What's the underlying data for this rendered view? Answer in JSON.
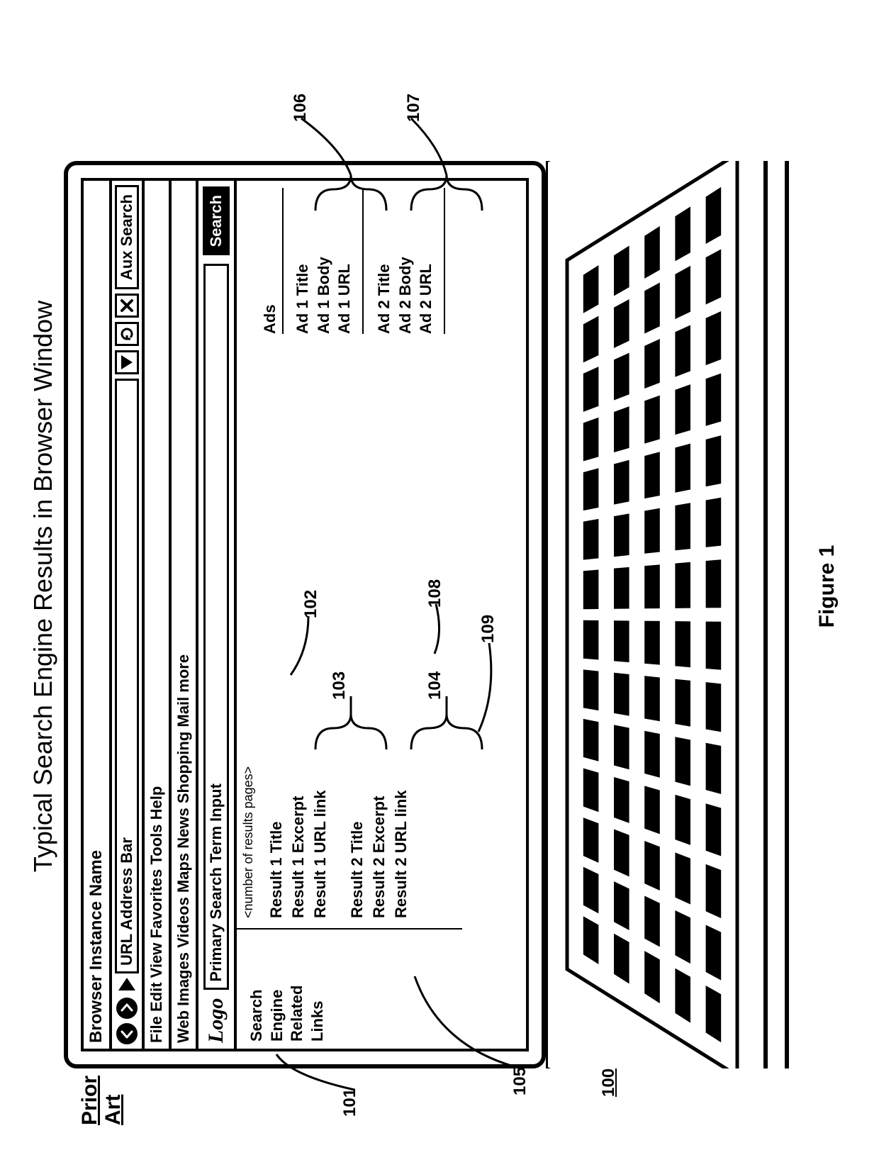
{
  "page_title": "Typical Search Engine Results in Browser Window",
  "prior_art": {
    "l1": "Prior",
    "l2": "Art"
  },
  "figure_label": "Figure 1",
  "browser": {
    "instance_name": "Browser Instance Name",
    "url_bar_label": "URL Address Bar",
    "aux_search": "Aux Search",
    "menu": "File Edit View Favorites Tools Help",
    "nav": "Web Images Videos Maps News Shopping Mail more",
    "logo": "Logo",
    "search_placeholder": "Primary Search Term Input",
    "search_button": "Search",
    "results_meta": "<number of results pages>",
    "sidebar": {
      "l1": "Search",
      "l2": "Engine",
      "l3": "Related",
      "l4": "Links"
    },
    "results": [
      {
        "title": "Result 1 Title",
        "excerpt": "Result 1 Excerpt",
        "url": "Result 1 URL link"
      },
      {
        "title": "Result 2 Title",
        "excerpt": "Result 2 Excerpt",
        "url": "Result 2 URL link"
      }
    ],
    "ads_header": "Ads",
    "ads": [
      {
        "title": "Ad 1 Title",
        "body": "Ad 1 Body",
        "url": "Ad 1 URL"
      },
      {
        "title": "Ad 2 Title",
        "body": "Ad 2 Body",
        "url": "Ad 2 URL"
      }
    ]
  },
  "refs": {
    "r100": "100",
    "r101": "101",
    "r102": "102",
    "r103": "103",
    "r104": "104",
    "r105": "105",
    "r106": "106",
    "r107": "107",
    "r108": "108",
    "r109": "109"
  }
}
